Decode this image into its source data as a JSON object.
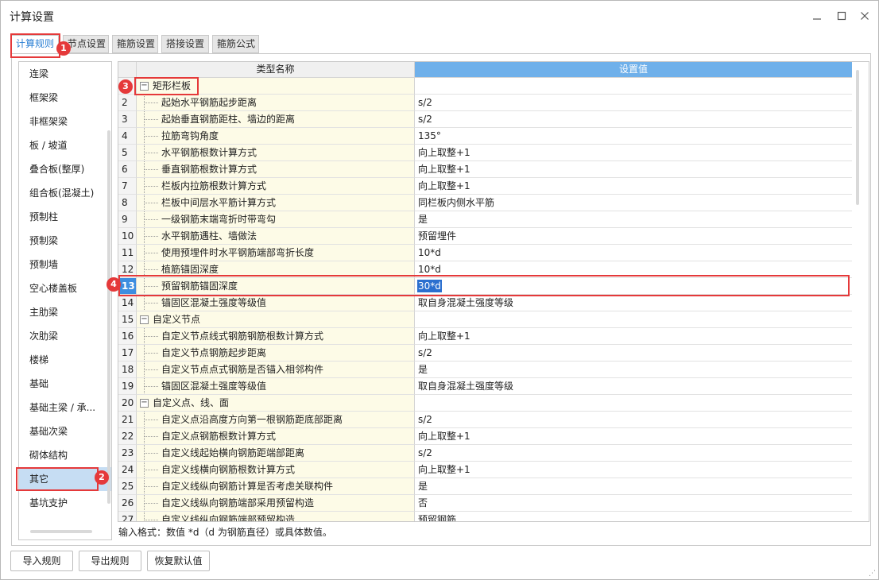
{
  "window": {
    "title": "计算设置",
    "minimize_icon": "minimize-icon",
    "maximize_icon": "maximize-icon",
    "close_icon": "close-icon"
  },
  "tabs": [
    {
      "label": "计算规则",
      "active": true
    },
    {
      "label": "节点设置",
      "active": false
    },
    {
      "label": "箍筋设置",
      "active": false
    },
    {
      "label": "搭接设置",
      "active": false
    },
    {
      "label": "箍筋公式",
      "active": false
    }
  ],
  "sidebar": {
    "items": [
      {
        "label": "连梁"
      },
      {
        "label": "框架梁"
      },
      {
        "label": "非框架梁"
      },
      {
        "label": "板 / 坡道"
      },
      {
        "label": "叠合板(整厚)"
      },
      {
        "label": "组合板(混凝土)"
      },
      {
        "label": "预制柱"
      },
      {
        "label": "预制梁"
      },
      {
        "label": "预制墙"
      },
      {
        "label": "空心楼盖板"
      },
      {
        "label": "主肋梁"
      },
      {
        "label": "次肋梁"
      },
      {
        "label": "楼梯"
      },
      {
        "label": "基础"
      },
      {
        "label": "基础主梁 / 承..."
      },
      {
        "label": "基础次梁"
      },
      {
        "label": "砌体结构"
      },
      {
        "label": "其它"
      },
      {
        "label": "基坑支护"
      }
    ],
    "selected_index": 17
  },
  "grid": {
    "header_name": "类型名称",
    "header_value": "设置值",
    "rows": [
      {
        "num": "",
        "name": "矩形栏板",
        "value": "",
        "group": true
      },
      {
        "num": "2",
        "name": "起始水平钢筋起步距离",
        "value": "s/2",
        "group": false
      },
      {
        "num": "3",
        "name": "起始垂直钢筋距柱、墙边的距离",
        "value": "s/2",
        "group": false
      },
      {
        "num": "4",
        "name": "拉筋弯钩角度",
        "value": "135°",
        "group": false
      },
      {
        "num": "5",
        "name": "水平钢筋根数计算方式",
        "value": "向上取整+1",
        "group": false
      },
      {
        "num": "6",
        "name": "垂直钢筋根数计算方式",
        "value": "向上取整+1",
        "group": false
      },
      {
        "num": "7",
        "name": "栏板内拉筋根数计算方式",
        "value": "向上取整+1",
        "group": false
      },
      {
        "num": "8",
        "name": "栏板中间层水平筋计算方式",
        "value": "同栏板内侧水平筋",
        "group": false
      },
      {
        "num": "9",
        "name": "一级钢筋末端弯折时带弯勾",
        "value": "是",
        "group": false
      },
      {
        "num": "10",
        "name": "水平钢筋遇柱、墙做法",
        "value": "预留埋件",
        "group": false
      },
      {
        "num": "11",
        "name": "使用预埋件时水平钢筋端部弯折长度",
        "value": "10*d",
        "group": false
      },
      {
        "num": "12",
        "name": "植筋锚固深度",
        "value": "10*d",
        "group": false
      },
      {
        "num": "13",
        "name": "预留钢筋锚固深度",
        "value": "30*d",
        "group": false,
        "selected": true
      },
      {
        "num": "14",
        "name": "锚固区混凝土强度等级值",
        "value": "取自身混凝土强度等级",
        "group": false
      },
      {
        "num": "15",
        "name": "自定义节点",
        "value": "",
        "group": true
      },
      {
        "num": "16",
        "name": "自定义节点线式钢筋钢筋根数计算方式",
        "value": "向上取整+1",
        "group": false
      },
      {
        "num": "17",
        "name": "自定义节点钢筋起步距离",
        "value": "s/2",
        "group": false
      },
      {
        "num": "18",
        "name": "自定义节点点式钢筋是否锚入相邻构件",
        "value": "是",
        "group": false
      },
      {
        "num": "19",
        "name": "锚固区混凝土强度等级值",
        "value": "取自身混凝土强度等级",
        "group": false
      },
      {
        "num": "20",
        "name": "自定义点、线、面",
        "value": "",
        "group": true
      },
      {
        "num": "21",
        "name": "自定义点沿高度方向第一根钢筋距底部距离",
        "value": "s/2",
        "group": false
      },
      {
        "num": "22",
        "name": "自定义点钢筋根数计算方式",
        "value": "向上取整+1",
        "group": false
      },
      {
        "num": "23",
        "name": "自定义线起始横向钢筋距端部距离",
        "value": "s/2",
        "group": false
      },
      {
        "num": "24",
        "name": "自定义线横向钢筋根数计算方式",
        "value": "向上取整+1",
        "group": false
      },
      {
        "num": "25",
        "name": "自定义线纵向钢筋计算是否考虑关联构件",
        "value": "是",
        "group": false
      },
      {
        "num": "26",
        "name": "自定义线纵向钢筋端部采用预留构造",
        "value": "否",
        "group": false
      },
      {
        "num": "27",
        "name": "自定义线纵向钢筋端部预留构造",
        "value": "预留钢筋",
        "group": false
      }
    ]
  },
  "hint": "输入格式：数值 *d（d 为钢筋直径）或具体数值。",
  "badges": [
    "1",
    "2",
    "3",
    "4"
  ],
  "footer": {
    "import_label": "导入规则",
    "export_label": "导出规则",
    "restore_label": "恢复默认值"
  },
  "colors": {
    "accent": "#2a7fd4",
    "highlight": "#e5393a",
    "header_value_bg": "#6fb0ea",
    "name_col_bg": "#fdfbe7",
    "selection": "#3e8ee0"
  }
}
